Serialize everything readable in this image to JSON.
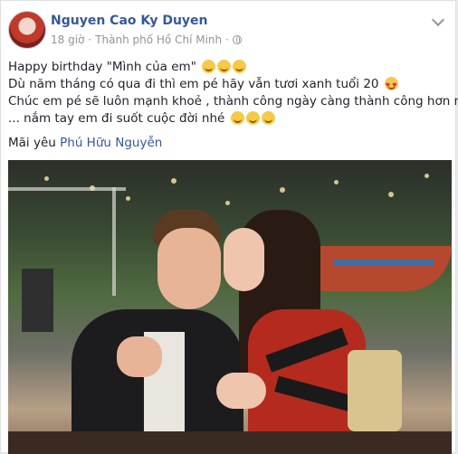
{
  "post": {
    "author": "Nguyen Cao Ky Duyen",
    "time": "18 giờ",
    "separator": "·",
    "location": "Thành phố Hồ Chí Minh",
    "separator2": "·",
    "lines": [
      "Happy birthday \"Mình của em\"",
      "Dù năm tháng có qua đi thì em pé hãy vẫn tươi xanh tuổi 20",
      "Chúc em pé sẽ luôn mạnh khoẻ , thành công ngày càng thành công hơn nữa",
      "... nắm tay em đi suốt cuộc đời nhé"
    ],
    "closing_prefix": "Mãi yêu",
    "tagged_person": "Phú Hữu Nguyễn"
  },
  "icons": {
    "avatar": "avatar",
    "privacy": "globe-icon",
    "menu": "chevron-down-icon",
    "emoji": "grinning-emoji",
    "heart_eyes": "heart-eyes-emoji"
  },
  "colors": {
    "link": "#365899",
    "meta": "#90949c",
    "text": "#1d2129"
  }
}
